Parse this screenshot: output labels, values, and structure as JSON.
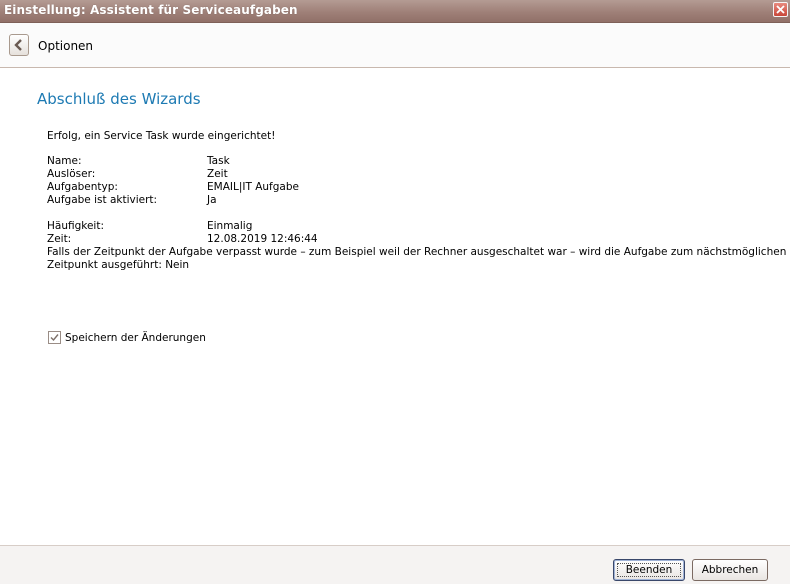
{
  "window": {
    "title": "Einstellung: Assistent für Serviceaufgaben",
    "close_icon": "close-icon"
  },
  "nav": {
    "back_icon": "chevron-left-icon",
    "label": "Optionen"
  },
  "main": {
    "heading": "Abschluß des Wizards",
    "success_message": "Erfolg, ein Service Task wurde eingerichtet!",
    "details_group1": [
      {
        "label": "Name:",
        "value": "Task"
      },
      {
        "label": "Auslöser:",
        "value": "Zeit"
      },
      {
        "label": "Aufgabentyp:",
        "value": "EMAIL|IT Aufgabe"
      },
      {
        "label": "Aufgabe ist aktiviert:",
        "value": "Ja"
      }
    ],
    "details_group2": [
      {
        "label": "Häufigkeit:",
        "value": "Einmalig"
      },
      {
        "label": "Zeit:",
        "value": "12.08.2019 12:46:44"
      }
    ],
    "missed_note_line1": "Falls der Zeitpunkt der Aufgabe verpasst wurde – zum Beispiel weil der Rechner ausgeschaltet war – wird die Aufgabe zum nächstmöglichen",
    "missed_note_line2": "Zeitpunkt ausgeführt: Nein",
    "save_checkbox": {
      "label": "Speichern der Änderungen",
      "checked": true
    }
  },
  "footer": {
    "finish_label": "Beenden",
    "cancel_label": "Abbrechen"
  },
  "colors": {
    "titlebar": "#9f8078",
    "heading": "#1d7ab3",
    "close_button": "#c9473a"
  }
}
